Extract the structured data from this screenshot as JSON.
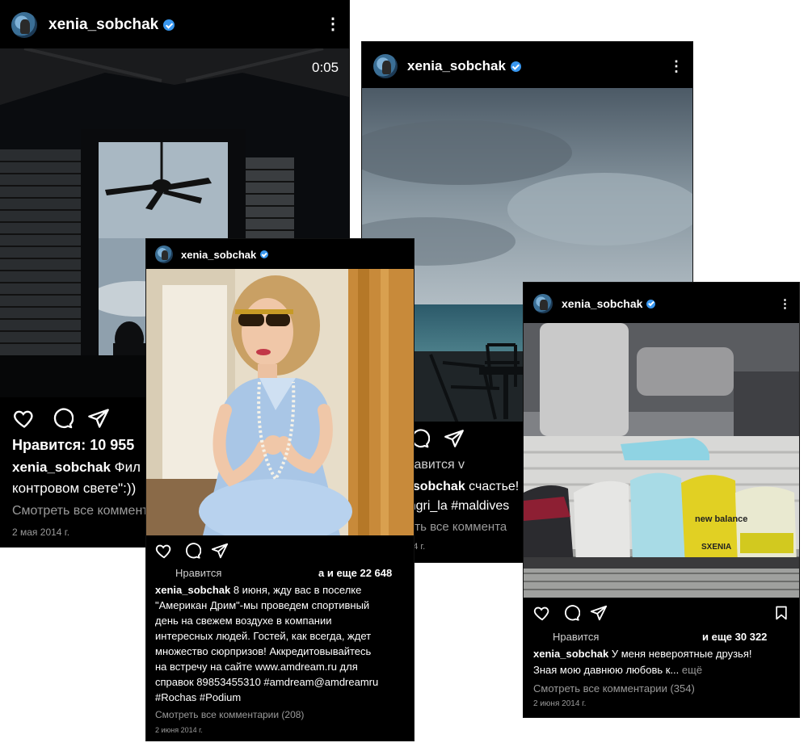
{
  "post1": {
    "username": "xenia_sobchak",
    "video_time": "0:05",
    "likes": "Нравится: 10 955",
    "caption_user": "xenia_sobchak",
    "caption_line1": "Фил",
    "caption_line2": "контровом свете\":))",
    "view_comments": "Смотреть все коммент",
    "date": "2 мая 2014 г."
  },
  "post2": {
    "username": "xenia_sobchak",
    "likes_prefix": "Нравится",
    "likes_suffix": "а и еще 22 648",
    "caption_user": "xenia_sobchak",
    "caption_lines": [
      " 8 июня, жду вас в поселке",
      "\"Американ Дрим\"-мы проведем спортивный",
      "день на свежем воздухе в компании",
      "интересных людей. Гостей, как всегда, ждет",
      "множество сюрпризов! Аккредитовывайтесь",
      "на встречу на сайте www.amdream.ru для",
      "справок 89853455310 #amdream@amdreamru",
      "#Rochas #Podium"
    ],
    "view_comments": "Смотреть все комментарии (208)",
    "date": "2 июня 2014 г."
  },
  "post3": {
    "username": "xenia_sobchak",
    "likes": "Нравится v",
    "caption_user": "xenia_sobchak",
    "caption_line1": " счастье!",
    "caption_line2": "@Shangri_la #maldives",
    "view_comments": "Смотреть все коммента",
    "date": "2 мая 2014 г."
  },
  "post4": {
    "username": "xenia_sobchak",
    "likes_prefix": "Нравится",
    "likes_suffix": "и еще 30 322",
    "caption_user": "xenia_sobchak",
    "caption_line1": " У меня невероятные друзья!",
    "caption_line2": "Зная мою давнюю любовь к... ",
    "caption_more": "ещё",
    "view_comments": "Смотреть все комментарии (354)",
    "date": "2 июня 2014 г.",
    "shoe_logo": "new balance",
    "shoe_name": "SXENIA"
  },
  "colors": {
    "verified": "#3897f0",
    "muted": "#9a9a9a",
    "card_bg": "#000000"
  }
}
